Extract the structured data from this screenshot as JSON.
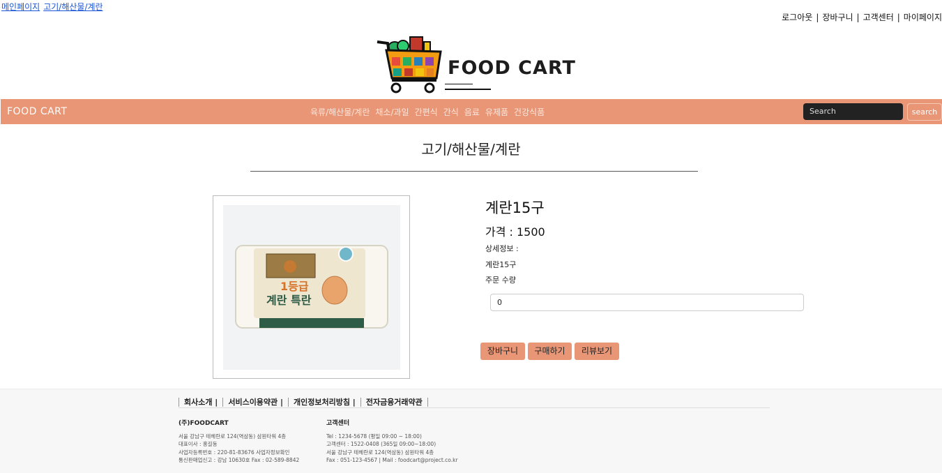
{
  "breadcrumb": [
    "메인페이지",
    "고기/해산물/계란"
  ],
  "top_nav": [
    "로그아웃",
    "장바구니",
    "고객센터",
    "마이페이지"
  ],
  "logo": {
    "text": "FOOD CART"
  },
  "navbar": {
    "brand": "FOOD CART",
    "menu": [
      "육류/해산물/계란",
      "채소/과일",
      "간편식",
      "간식",
      "음료",
      "유제품",
      "건강식품"
    ],
    "search_placeholder": "Search",
    "search_button": "search"
  },
  "category_title": "고기/해산물/계란",
  "product": {
    "image_text_grade": "1등급",
    "image_text_name": "계란 특란",
    "name": "계란15구",
    "price": "가격 : 1500",
    "detail_label": "상세정보 :",
    "detail_value": "계란15구",
    "qty_label": "주문 수량",
    "qty_value": "0"
  },
  "buttons": {
    "cart": "장바구니",
    "buy": "구매하기",
    "review": "리뷰보기"
  },
  "footer": {
    "links": [
      "회사소개 |",
      "서비스이용약관 |",
      "개인정보처리방침 |",
      "전자금융거래약관"
    ],
    "company": {
      "title": "(주)FOODCART",
      "lines": [
        "서울 강남구 테헤란로 124(역삼동) 삼원타워 4층",
        "대표이사 : 홍길동",
        "사업자등록번호 : 220-81-83676 사업자정보확인",
        "통신판매업신고 : 강남 10630호 Fax : 02-589-8842"
      ]
    },
    "support": {
      "title": "고객센터",
      "lines": [
        "Tel : 1234-5678 (평일 09:00 ~ 18:00)",
        "고객센터 : 1522-0408 (365일 09:00~18:00)",
        "서울 강남구 테헤란로 124(역삼동) 삼원타워 4층",
        "Fax : 051-123-4567 | Mail : foodcart@project.co.kr"
      ]
    }
  },
  "colors": {
    "accent": "#e99676",
    "search_bg": "#222222"
  }
}
